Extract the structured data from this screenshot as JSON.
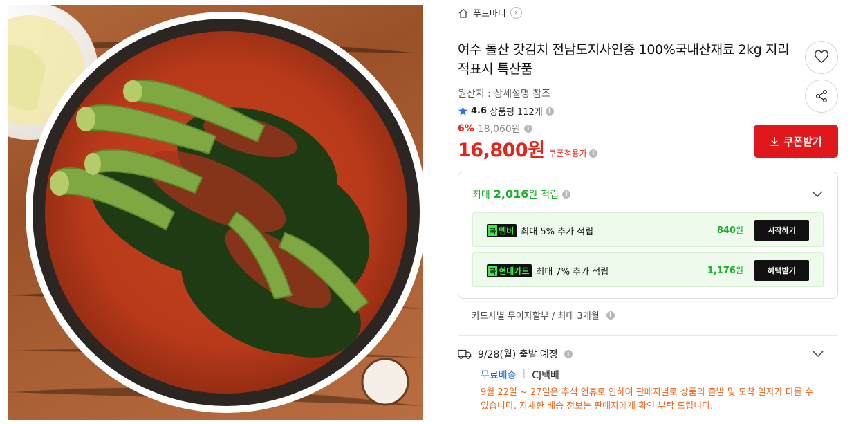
{
  "breadcrumb": {
    "brand": "푸드마니"
  },
  "product": {
    "title": "여수 돌산 갓김치 전남도지사인증 100%국내산재료 2kg 지리적표시 특산품",
    "origin": "원산지 : 상세설명 참조",
    "rating": {
      "score": "4.6",
      "review_label": "상품평",
      "review_count": "112개"
    },
    "discount_rate": "6%",
    "original_price": "18,060원",
    "price": "16,800원",
    "coupon_note": "쿠폰적용가"
  },
  "buttons": {
    "coupon": "쿠폰받기",
    "wishlist_icon": "heart-icon",
    "share_icon": "share-icon"
  },
  "reward": {
    "prefix": "최대",
    "amount": "2,016",
    "unit": "원",
    "suffix": "적립",
    "items": [
      {
        "tag_prefix": "꼭",
        "tag": "멤버",
        "text": "최대 5% 추가 적립",
        "amount": "840",
        "unit": "원",
        "button": "시작하기"
      },
      {
        "tag_prefix": "꼭",
        "tag": "현대카드",
        "text": "최대 7% 추가 적립",
        "amount": "1,176",
        "unit": "원",
        "button": "혜택받기"
      }
    ]
  },
  "installment": "카드사별 무이자할부 / 최대 3개월",
  "shipping": {
    "date": "9/28(월) 출발 예정",
    "type": "무료배송",
    "carrier": "CJ택배",
    "notice": "9월 22일 ~ 27일은 추석 연휴로 인하여 판매지별로 상품의 출발 및 도착 일자가 다를 수 있습니다. 자세한 배송 정보는 판매자에게 확인 부탁 드립니다."
  },
  "colors": {
    "accent_red": "#e0171b",
    "reward_green": "#1aad28",
    "notice_orange": "#ec6316",
    "link_blue": "#1f72d6"
  }
}
